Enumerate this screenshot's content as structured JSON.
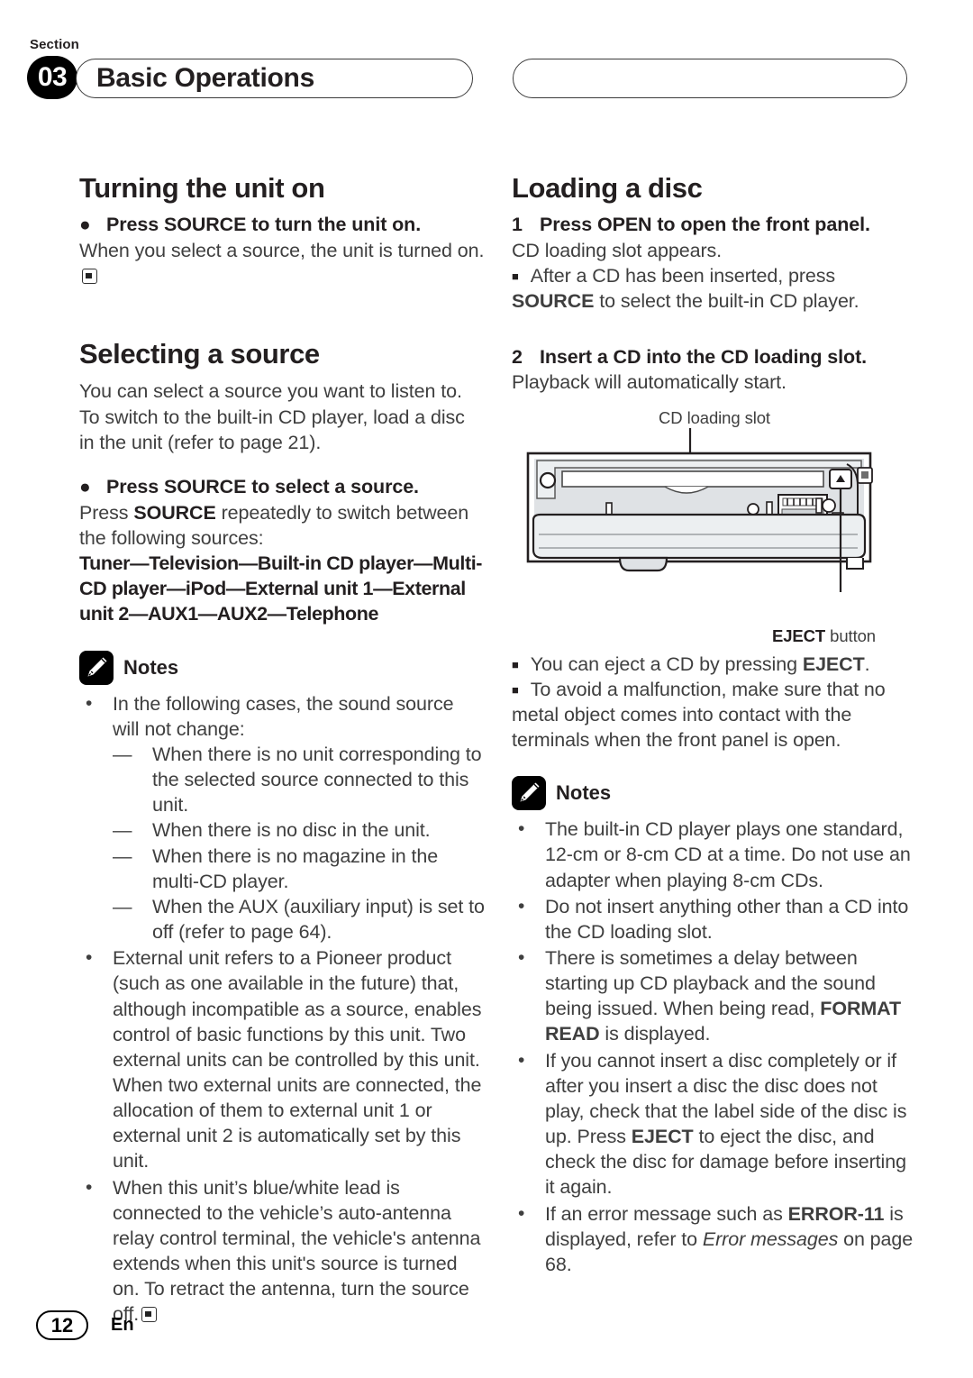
{
  "header": {
    "section_label": "Section",
    "section_number": "03",
    "title": "Basic Operations",
    "right_pill_text": ""
  },
  "left_column": {
    "heading_1": "Turning the unit on",
    "op_1": {
      "bullet": "●",
      "text": "Press SOURCE to turn the unit on."
    },
    "op_1_body": "When you select a source, the unit is turned on.",
    "heading_2": "Selecting a source",
    "intro": "You can select a source you want to listen to. To switch to the built-in CD player, load a disc in the unit (refer to page 21).",
    "op_2": {
      "bullet": "●",
      "text": "Press SOURCE to select a source."
    },
    "op_2_body_pre": "Press ",
    "op_2_body_bold": "SOURCE",
    "op_2_body_post": " repeatedly to switch between the following sources:",
    "source_chain": "Tuner—Television—Built-in CD player—Multi-CD player—iPod—External unit 1—External unit 2—AUX1—AUX2—Telephone",
    "notes_title": "Notes",
    "notes": [
      {
        "marker": "•",
        "text": "In the following cases, the sound source will not change:",
        "sub": [
          {
            "marker": "—",
            "text": "When there is no unit corresponding to the selected source connected to this unit."
          },
          {
            "marker": "—",
            "text": "When there is no disc in the unit."
          },
          {
            "marker": "—",
            "text": "When there is no magazine in the multi-CD player."
          },
          {
            "marker": "—",
            "text": "When the AUX (auxiliary input) is set to off (refer to page 64)."
          }
        ]
      },
      {
        "marker": "•",
        "text": "External unit refers to a Pioneer product (such as one available in the future) that, although incompatible as a source, enables control of basic functions by this unit. Two external units can be controlled by this unit. When two external units are connected, the allocation of them to external unit 1 or external unit 2 is automatically set by this unit."
      },
      {
        "marker": "•",
        "text": "When this unit’s blue/white lead is connected to the vehicle’s auto-antenna relay control terminal, the vehicle's antenna extends when this unit's source is turned on. To retract the antenna, turn the source off.",
        "end_marker": true
      }
    ]
  },
  "right_column": {
    "heading_1": "Loading a disc",
    "step_1": {
      "number": "1",
      "text": "Press OPEN to open the front panel."
    },
    "step_1_body": "CD loading slot appears.",
    "step_1_note": {
      "marker": "■",
      "pre": "After a CD has been inserted, press ",
      "bold": "SOURCE",
      "post": " to select the built-in CD player."
    },
    "step_2": {
      "number": "2",
      "text": "Insert a CD into the CD loading slot."
    },
    "step_2_body": "Playback will automatically start.",
    "figure": {
      "caption_top": "CD loading slot",
      "caption_bottom_bold": "EJECT",
      "caption_bottom_rest": " button",
      "eject_glyph": "▲"
    },
    "square_notes": [
      {
        "marker": "■",
        "pre": "You can eject a CD by pressing ",
        "bold": "EJECT",
        "post": "."
      },
      {
        "marker": "■",
        "pre": "To avoid a malfunction, make sure that no metal object comes into contact with the terminals when the front panel is open.",
        "bold": "",
        "post": ""
      }
    ],
    "notes_title": "Notes",
    "notes": [
      {
        "marker": "•",
        "text": "The built-in CD player plays one standard, 12-cm or 8-cm CD at a time. Do not use an adapter when playing 8-cm CDs."
      },
      {
        "marker": "•",
        "text": "Do not insert anything other than a CD into the CD loading slot."
      },
      {
        "marker": "•",
        "pre": "There is sometimes a delay between starting up CD playback and the sound being issued. When being read, ",
        "bold": "FORMAT READ",
        "post": " is displayed."
      },
      {
        "marker": "•",
        "pre": "If you cannot insert a disc completely or if after you insert a disc the disc does not play, check that the label side of the disc is up. Press ",
        "bold": "EJECT",
        "post": " to eject the disc, and check the disc for damage before inserting it again."
      },
      {
        "marker": "•",
        "pre": "If an error message such as ",
        "bold": "ERROR-11",
        "mid": " is displayed, refer to ",
        "italic": "Error messages",
        "post": " on page 68."
      }
    ]
  },
  "footer": {
    "page_number": "12",
    "language": "En"
  }
}
